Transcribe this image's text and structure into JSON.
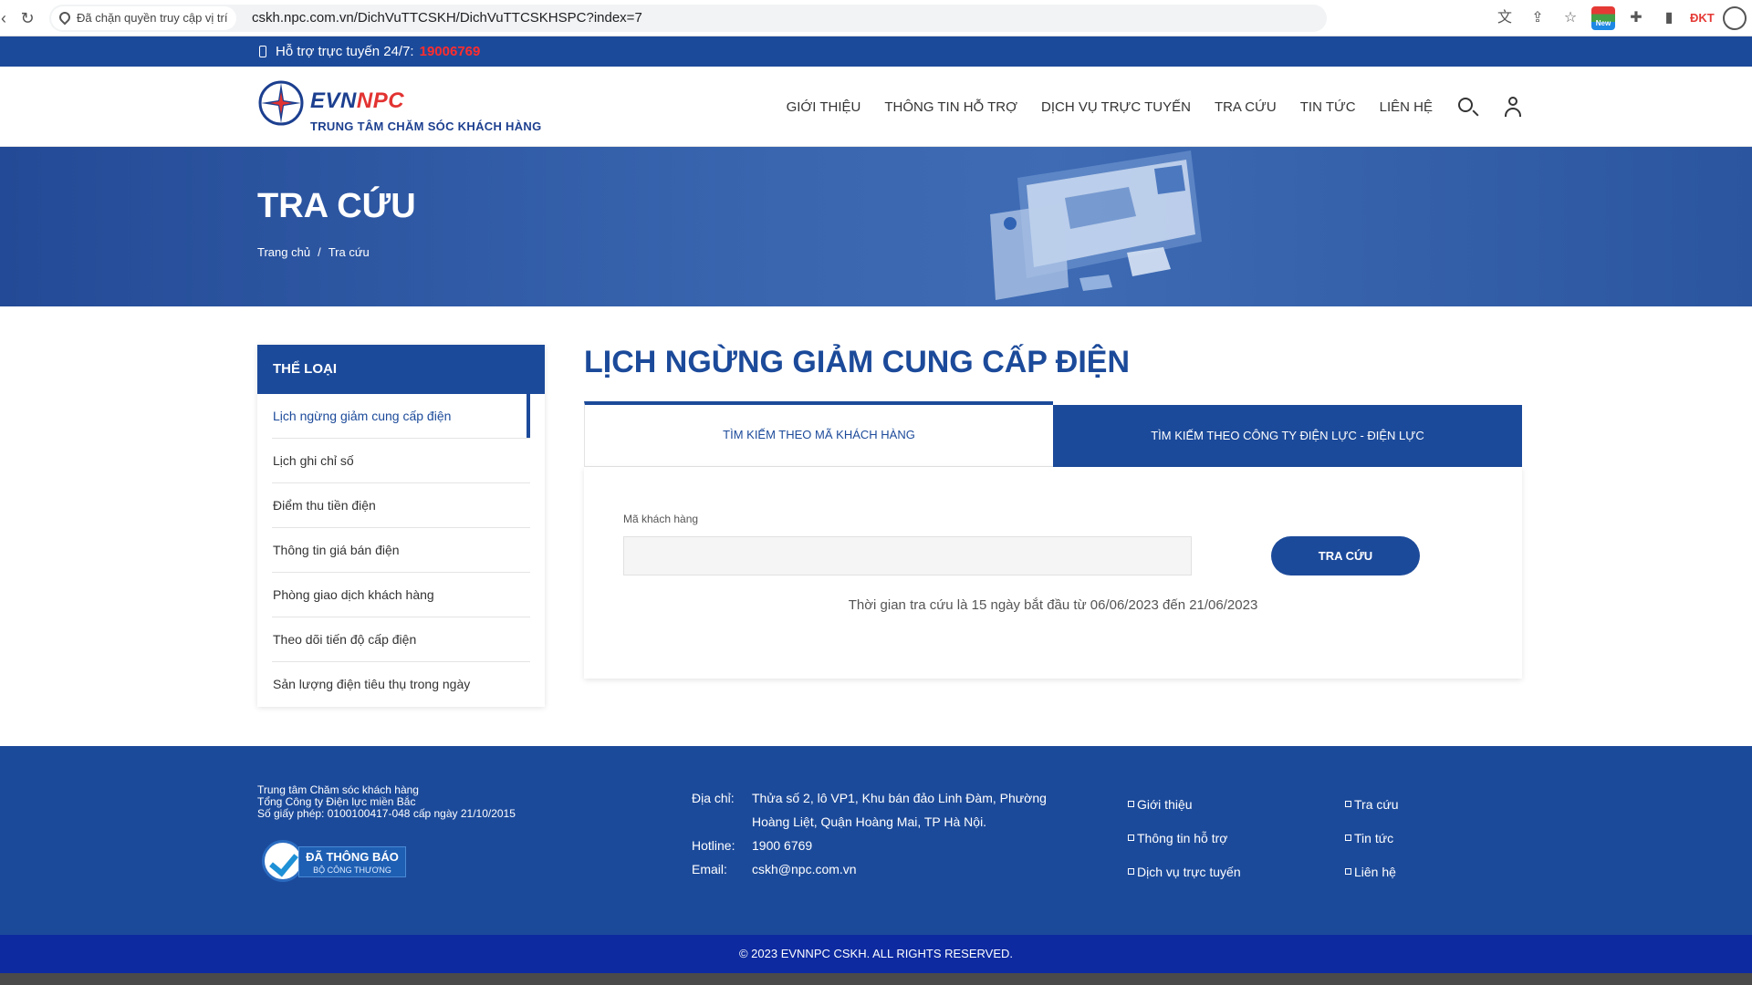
{
  "browser": {
    "site_info": "Đã chặn quyền truy cập vị trí",
    "url": "cskh.npc.com.vn/DichVuTTCSKH/DichVuTTCSKHSPC?index=7",
    "reload_glyph": "↻",
    "actions": [
      "文",
      "⇪",
      "☆"
    ],
    "ext_badge": "New",
    "ext_dkt": "ĐKT",
    "puzzle_glyph": "✚",
    "sidepanel_glyph": "▮"
  },
  "support": {
    "label": "Hỗ trợ trực tuyến 24/7:",
    "hotline": "19006769"
  },
  "brand": {
    "name_evn": "EVN",
    "name_npc": "NPC",
    "subtitle": "TRUNG TÂM CHĂM SÓC KHÁCH HÀNG"
  },
  "nav": {
    "items": [
      "GIỚI THIỆU",
      "THÔNG TIN HỖ TRỢ",
      "DỊCH VỤ TRỰC TUYẾN",
      "TRA CỨU",
      "TIN TỨC",
      "LIÊN HỆ"
    ]
  },
  "banner": {
    "title": "TRA CỨU",
    "breadcrumb": [
      "Trang chủ",
      "Tra cứu"
    ],
    "breadcrumb_sep": "/"
  },
  "sidebar": {
    "title": "THỂ LOẠI",
    "items": [
      "Lịch ngừng giảm cung cấp điện",
      "Lịch ghi chỉ số",
      "Điểm thu tiền điện",
      "Thông tin giá bán điện",
      "Phòng giao dịch khách hàng",
      "Theo dõi tiến độ cấp điện",
      "Sản lượng điện tiêu thụ trong ngày"
    ]
  },
  "main": {
    "title": "LỊCH NGỪNG GIẢM CUNG CẤP ĐIỆN",
    "tabs": [
      "TÌM KIẾM THEO MÃ KHÁCH HÀNG",
      "TÌM KIẾM THEO CÔNG TY ĐIỆN LỰC - ĐIỆN LỰC"
    ],
    "field_label": "Mã khách hàng",
    "field_value": "",
    "submit_label": "TRA CỨU",
    "date_note": "Thời gian tra cứu là 15 ngày bắt đầu từ 06/06/2023 đến 21/06/2023"
  },
  "footer": {
    "org_lines": [
      "Trung tâm Chăm sóc khách hàng",
      "Tổng Công ty Điện lực miền Bắc",
      "Số giấy phép: 0100100417-048 cấp ngày 21/10/2015"
    ],
    "badge_line1": "ĐÃ THÔNG BÁO",
    "badge_line2": "BỘ CÔNG THƯƠNG",
    "address_label": "Địa chỉ:",
    "address": "Thửa số 2, lô VP1, Khu bán đảo Linh Đàm, Phường Hoàng Liệt, Quận Hoàng Mai, TP Hà Nội.",
    "hotline_label": "Hotline:",
    "hotline": "1900 6769",
    "email_label": "Email:",
    "email": "cskh@npc.com.vn",
    "links_col1": [
      "Giới thiệu",
      "Thông tin hỗ trợ",
      "Dịch vụ trực tuyến"
    ],
    "links_col2": [
      "Tra cứu",
      "Tin tức",
      "Liên hệ"
    ],
    "copyright": "© 2023 EVNNPC CSKH. ALL RIGHTS RESERVED."
  },
  "colors": {
    "primary": "#1c4a9a",
    "hotline_red": "#ff2d2d",
    "logo_red": "#e23331",
    "copyright_bg": "#0d2aa0"
  }
}
